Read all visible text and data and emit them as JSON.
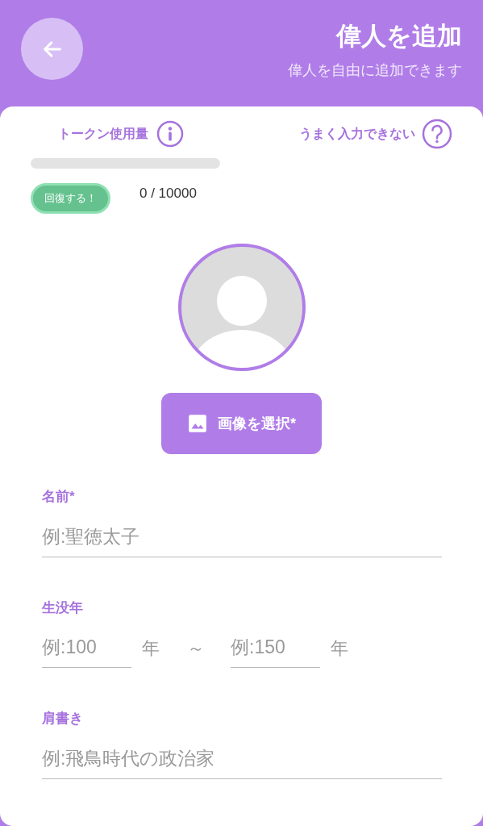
{
  "header": {
    "title": "偉人を追加",
    "subtitle": "偉人を自由に追加できます"
  },
  "tokens": {
    "label": "トークン使用量",
    "help": "うまく入力できない",
    "level": 0,
    "recover_button": "回復する！",
    "count": "0 / 10000"
  },
  "image_button": "画像を選択*",
  "fields": [
    {
      "kind": "text",
      "label": "名前*",
      "placeholder": "例:聖徳太子"
    },
    {
      "kind": "range",
      "label": "生没年",
      "from": {
        "placeholder": "例:100",
        "unit": "年"
      },
      "separator": "～",
      "to": {
        "placeholder": "例:150",
        "unit": "年"
      }
    },
    {
      "kind": "text",
      "label": "肩書き",
      "placeholder": "例:飛鳥時代の政治家"
    }
  ]
}
